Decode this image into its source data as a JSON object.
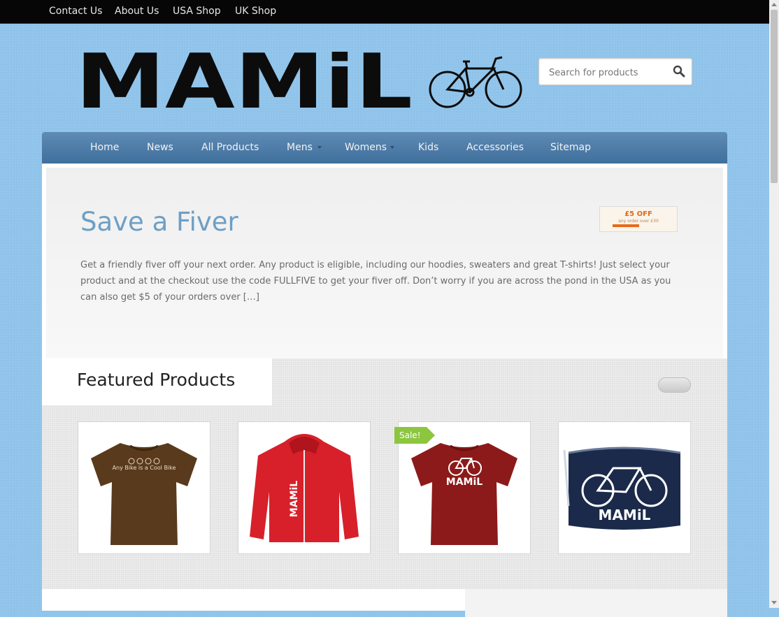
{
  "topbar": {
    "links": [
      "Contact Us",
      "About Us",
      "USA Shop",
      "UK Shop"
    ]
  },
  "header": {
    "logo_text": "MAMiL",
    "search": {
      "placeholder": "Search for products"
    }
  },
  "nav": {
    "items": [
      "Home",
      "News",
      "All Products",
      "Mens",
      "Womens",
      "Kids",
      "Accessories",
      "Sitemap"
    ]
  },
  "hero": {
    "title": "Save a Fiver",
    "body": "Get a friendly fiver off your next order. Any product is eligible, including our hoodies, sweaters and great T-shirts! Just select your product and at the checkout use the code FULLFIVE to get your fiver off.   Don’t worry if you are across the pond in the USA as you can also get $5 of your orders over […]",
    "promo": {
      "title": "£5 OFF",
      "subtitle": "any order over £30"
    }
  },
  "featured": {
    "title": "Featured Products",
    "products": [
      {
        "image": "brown-tshirt",
        "shirt_text": "Any Bike is a Cool Bike",
        "color": "#5a3a1c"
      },
      {
        "image": "red-hoodie",
        "shirt_text": "MAMiL",
        "color": "#d8202a"
      },
      {
        "image": "maroon-tshirt",
        "shirt_text": "MAMiL",
        "color": "#8c1a1a",
        "badge": "Sale!"
      },
      {
        "image": "navy-messenger-bag",
        "shirt_text": "MAMiL",
        "color": "#1b2a4a"
      }
    ]
  },
  "colors": {
    "page_bg": "#8fc3ea",
    "nav": "#4d7ba6",
    "title": "#6e9fc5",
    "sale": "#8cc63f"
  }
}
